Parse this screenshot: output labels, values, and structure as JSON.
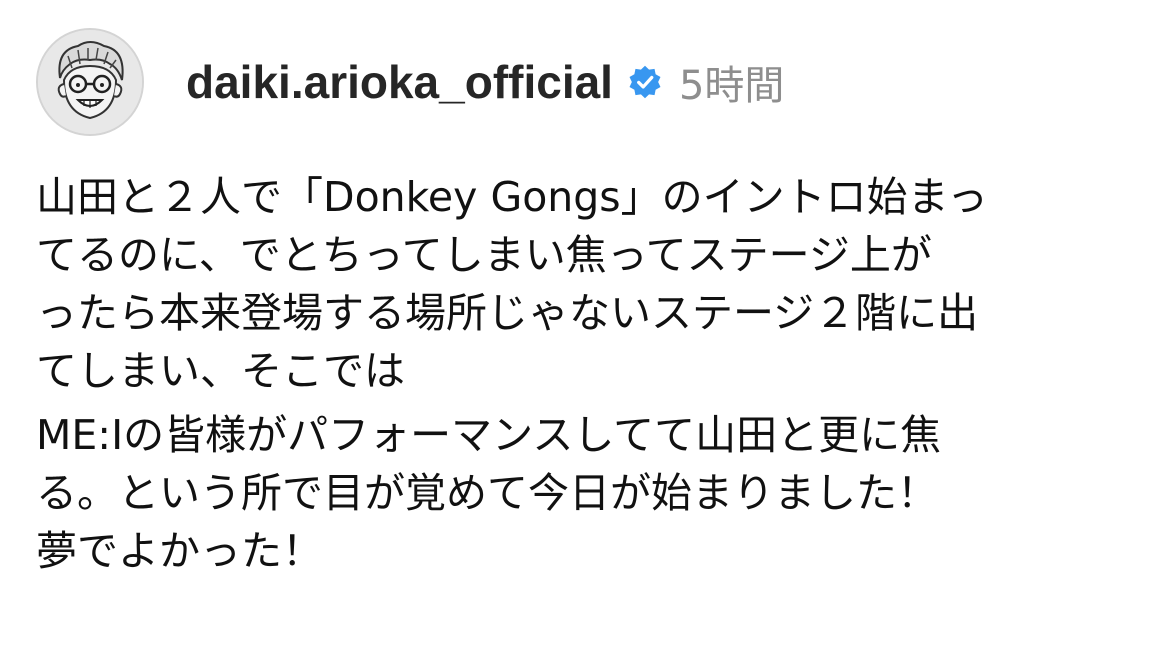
{
  "post": {
    "avatar_icon": "caricature-avatar-icon",
    "username": "daiki.arioka_official",
    "verified_icon": "verified-badge-icon",
    "verified_color": "#3897f0",
    "timestamp": "5時間"
  },
  "caption": {
    "paragraph1": [
      "山田と２人で「Donkey Gongs」のイントロ始まっ",
      "てるのに、でとちってしまい焦ってステージ上が",
      "ったら本来登場する場所じゃないステージ２階に出",
      "てしまい、そこでは"
    ],
    "paragraph2": [
      "ME:Iの皆様がパフォーマンスしてて山田と更に焦",
      "る。という所で目が覚めて今日が始まりました！",
      "夢でよかった！"
    ]
  }
}
